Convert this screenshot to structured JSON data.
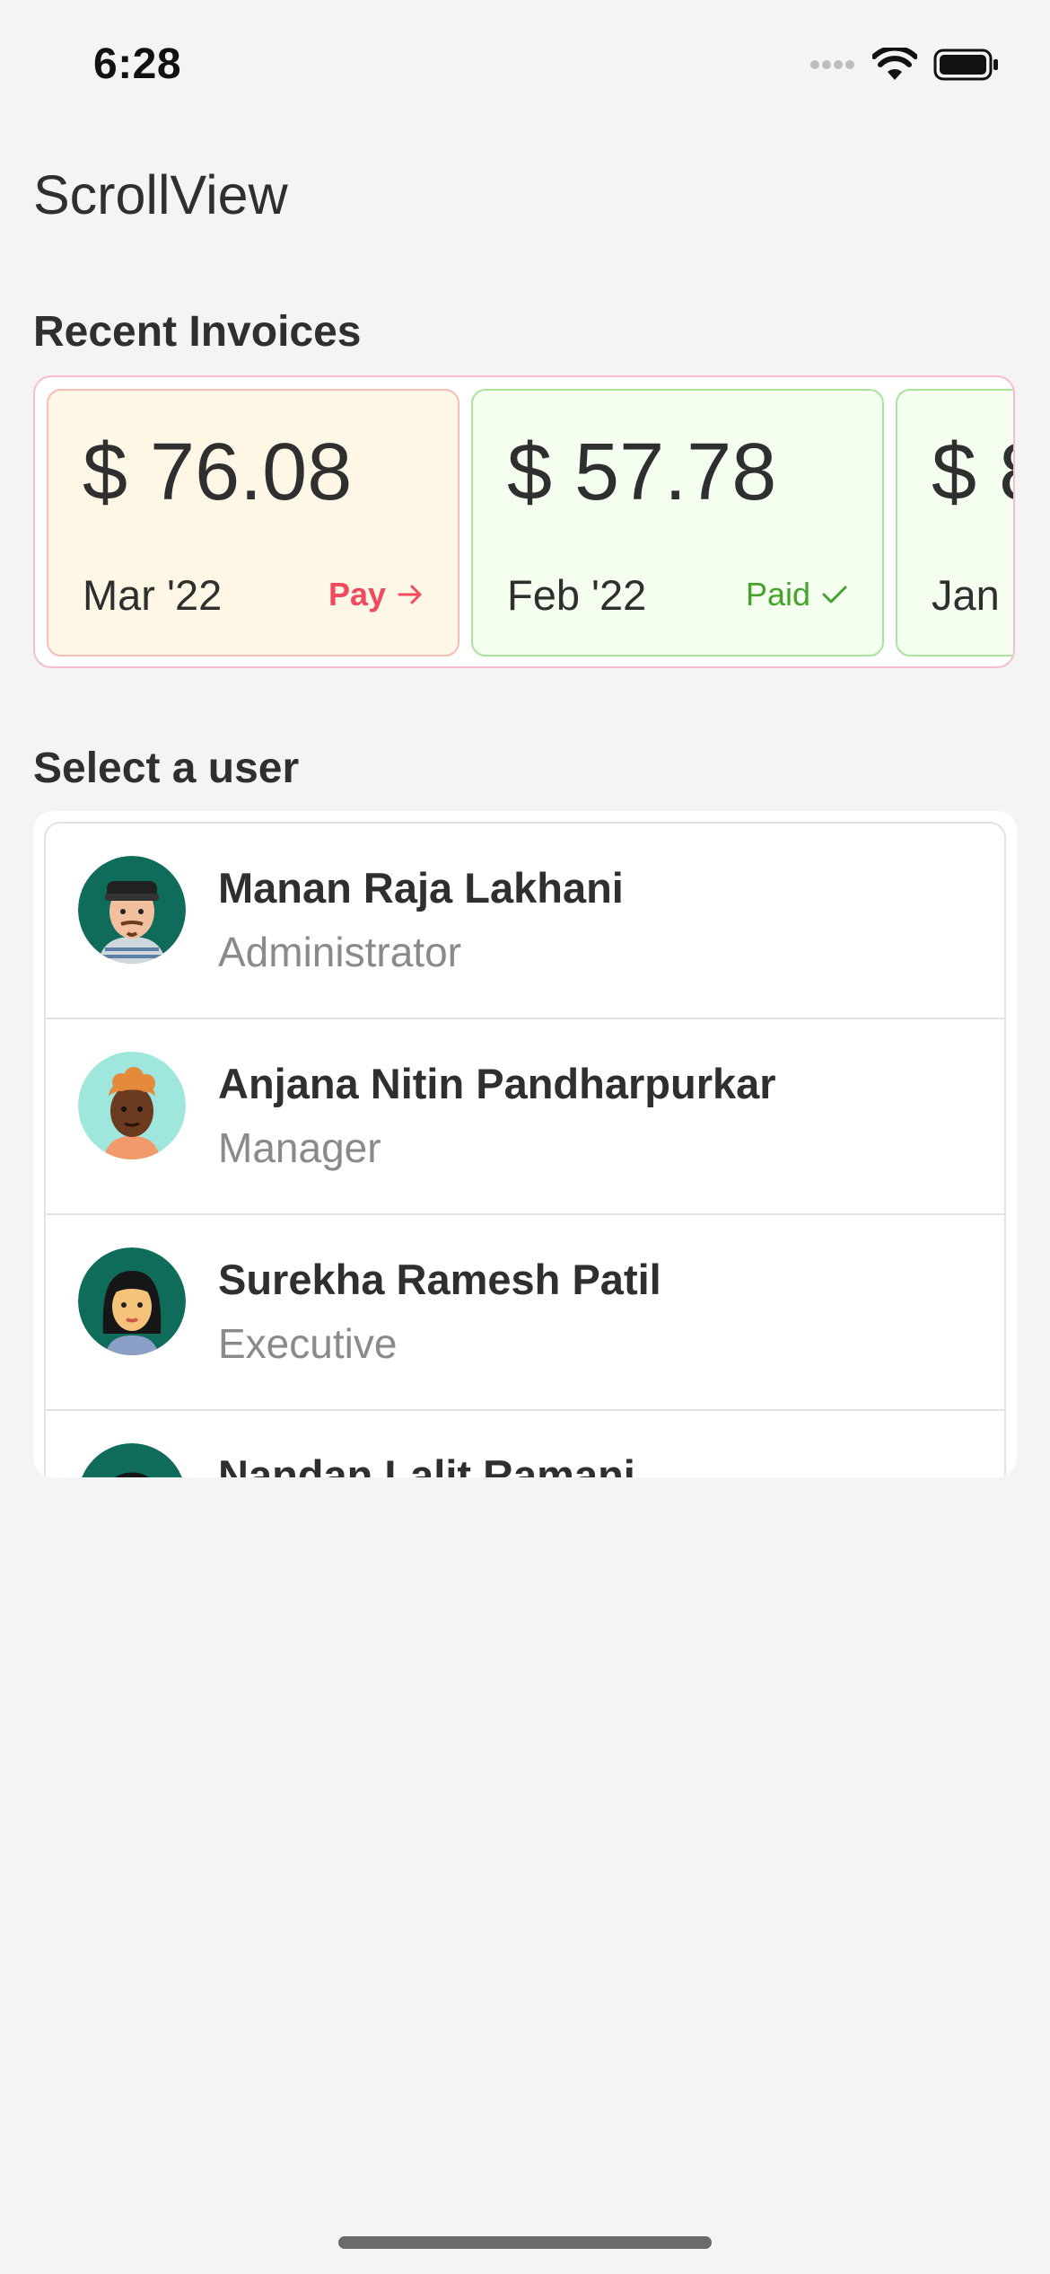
{
  "status_bar": {
    "time": "6:28"
  },
  "header": {
    "title": "ScrollView"
  },
  "invoices": {
    "section_title": "Recent Invoices",
    "cards": [
      {
        "amount": "$ 76.08",
        "month": "Mar '22",
        "action_label": "Pay",
        "action_icon": "arrow-right-icon",
        "status": "pay",
        "accent": "#ef4a5e"
      },
      {
        "amount": "$ 57.78",
        "month": "Feb '22",
        "action_label": "Paid",
        "action_icon": "checkmark-icon",
        "status": "paid",
        "accent": "#45a22d"
      },
      {
        "amount": "$ 8",
        "month": "Jan",
        "status": "paid"
      }
    ]
  },
  "users": {
    "section_title": "Select a user",
    "items": [
      {
        "name": "Manan Raja Lakhani",
        "role": "Administrator",
        "avatar_bg": "#0f6b5a"
      },
      {
        "name": "Anjana Nitin Pandharpurkar",
        "role": "Manager",
        "avatar_bg": "#9fe6dc"
      },
      {
        "name": "Surekha Ramesh Patil",
        "role": "Executive",
        "avatar_bg": "#0f6b5a"
      },
      {
        "name": "Nandan Lalit Ramani",
        "role": "",
        "avatar_bg": "#0f6b5a"
      }
    ]
  }
}
